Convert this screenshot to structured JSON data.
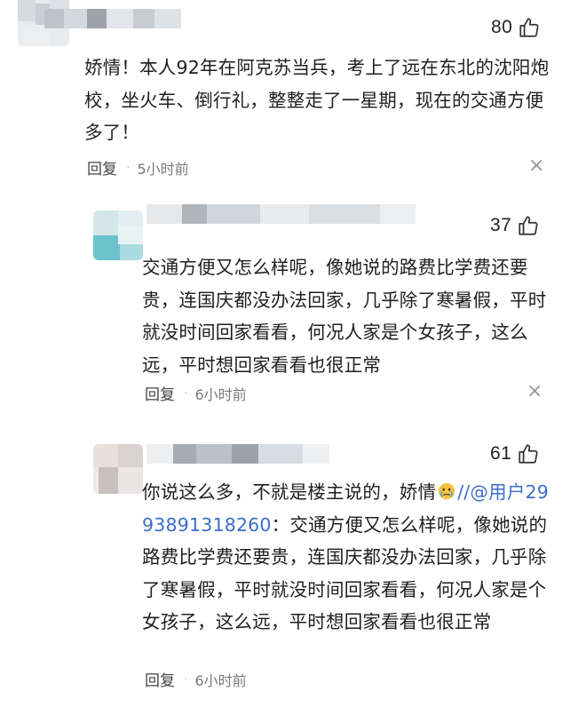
{
  "comments": [
    {
      "likes": "80",
      "text": "娇情！本人92年在阿克苏当兵，考上了远在东北的沈阳炮校，坐火车、倒行礼，整整走了一星期，现在的交通方便多了！",
      "reply_label": "回复",
      "separator": "·",
      "time": "5小时前",
      "more": "×"
    },
    {
      "likes": "37",
      "text": "交通方便又怎么样呢，像她说的路费比学费还要贵，连国庆都没办法回家，几乎除了寒暑假，平时就没时间回家看看，何况人家是个女孩子，这么远，平时想回家看看也很正常",
      "reply_label": "回复",
      "separator": "·",
      "time": "6小时前",
      "more": "×"
    },
    {
      "likes": "61",
      "text_before": "你说这么多，不就是楼主说的，娇情",
      "emoji": "crying-face-emoji",
      "mention": "//@用户2993891318260",
      "text_after": "：交通方便又怎么样呢，像她说的路费比学费还要贵，连国庆都没办法回家，几乎除了寒暑假，平时就没时间回家看看，何况人家是个女孩子，这么远，平时想回家看看也很正常",
      "reply_label": "回复",
      "separator": "·",
      "time": "6小时前"
    }
  ],
  "icons": {
    "like": "thumbs-up-icon",
    "more": "close-icon"
  },
  "colors": {
    "mention": "#3b6ecb",
    "text": "#1f1f1f",
    "muted": "#7a7a7a"
  }
}
